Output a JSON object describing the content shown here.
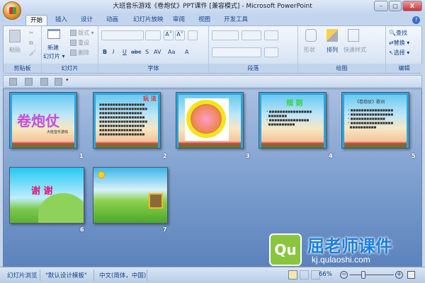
{
  "window": {
    "title": "大班音乐游戏《卷炮仗》PPT课件 [兼容模式] - Microsoft PowerPoint",
    "minimize": "–",
    "maximize": "□",
    "close": "X"
  },
  "tabs": [
    "开始",
    "插入",
    "设计",
    "动画",
    "幻灯片放映",
    "审阅",
    "视图",
    "开发工具"
  ],
  "help_icon": "?",
  "ribbon": {
    "clipboard": {
      "label": "剪贴板",
      "paste": "粘贴"
    },
    "slides": {
      "label": "幻灯片",
      "new_slide": "新建",
      "new_slide2": "幻灯片 ▾",
      "layout": "版式 ▾",
      "reset": "重设",
      "delete": "删除"
    },
    "font": {
      "label": "字体",
      "grow": "A˄",
      "shrink": "A˅",
      "bold": "B",
      "italic": "I",
      "underline": "U",
      "strike": "abc",
      "shadow": "S",
      "spacing": "AV",
      "case": "Aa",
      "color": "A"
    },
    "paragraph": {
      "label": "段落"
    },
    "drawing": {
      "label": "绘图",
      "shapes": "形状",
      "arrange": "排列",
      "quick_styles": "快速样式"
    },
    "editing": {
      "label": "编辑",
      "find": "查找",
      "replace": "替换 ▾",
      "select": "选择 ▾"
    }
  },
  "slides": [
    {
      "number": "1",
      "title": "卷炮仗",
      "subtitle": "大班音乐游戏"
    },
    {
      "number": "2",
      "title": "玩 法"
    },
    {
      "number": "3"
    },
    {
      "number": "4",
      "title": "规 则"
    },
    {
      "number": "5",
      "title": "《卷炮仗》歌词"
    },
    {
      "number": "6",
      "title": "谢 谢"
    },
    {
      "number": "7"
    }
  ],
  "statusbar": {
    "view": "幻灯片浏览",
    "theme": "\"默认设计模板\"",
    "language": "中文(简体，中国)",
    "zoom": "66%",
    "zoom_level": 66
  },
  "watermark": {
    "brand": "屈老师课件",
    "url": "kj.qulaoshi.com",
    "logo": "Qu"
  }
}
